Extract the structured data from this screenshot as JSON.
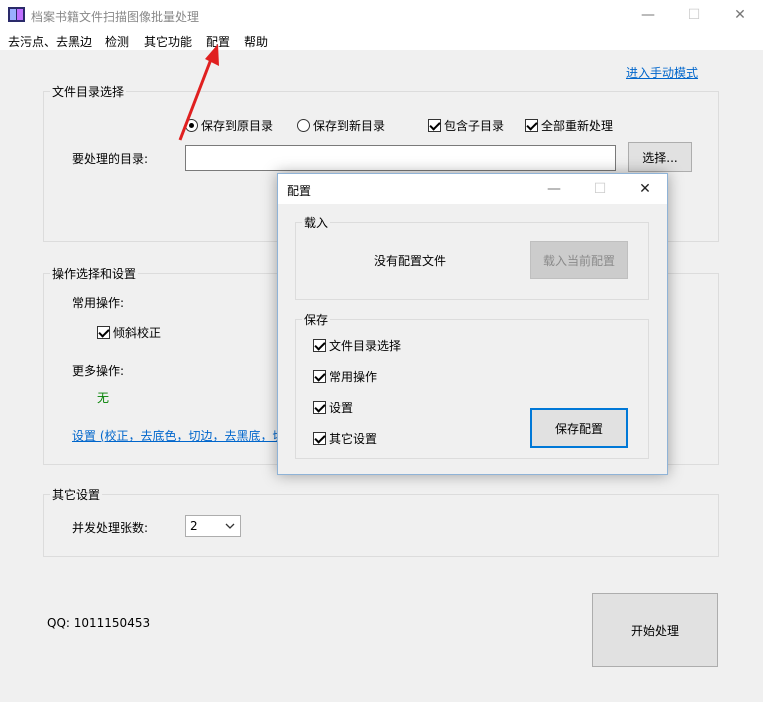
{
  "window": {
    "title": "档案书籍文件扫描图像批量处理",
    "minimize": "—",
    "maximize": "☐",
    "close": "✕"
  },
  "menu": [
    "去污点、去黑边",
    "检测",
    "其它功能",
    "配置",
    "帮助"
  ],
  "manual_mode_link": "进入手动模式",
  "file_group": {
    "legend": "文件目录选择",
    "save_original": "保存到原目录",
    "save_new": "保存到新目录",
    "include_sub": "包含子目录",
    "reprocess_all": "全部重新处理",
    "dir_label": "要处理的目录:",
    "dir_value": "",
    "select_button": "选择..."
  },
  "ops_group": {
    "legend": "操作选择和设置",
    "common_label": "常用操作:",
    "deskew": "倾斜校正",
    "more_label": "更多操作:",
    "more_value": "无",
    "settings_link": "设置 (校正，去底色，切边，去黑底，切"
  },
  "other_group": {
    "legend": "其它设置",
    "concurrent_label": "并发处理张数:",
    "concurrent_value": "2"
  },
  "qq": "QQ: 1011150453",
  "start_button": "开始处理",
  "dialog": {
    "title": "配置",
    "load_legend": "载入",
    "no_config": "没有配置文件",
    "load_button": "载入当前配置",
    "save_legend": "保存",
    "opt_file_dir": "文件目录选择",
    "opt_common": "常用操作",
    "opt_settings": "设置",
    "opt_other": "其它设置",
    "save_button": "保存配置"
  },
  "colors": {
    "link": "#0066cc",
    "none_value": "#008000",
    "arrow": "#e02020",
    "dialog_border": "#8fb3d7"
  }
}
